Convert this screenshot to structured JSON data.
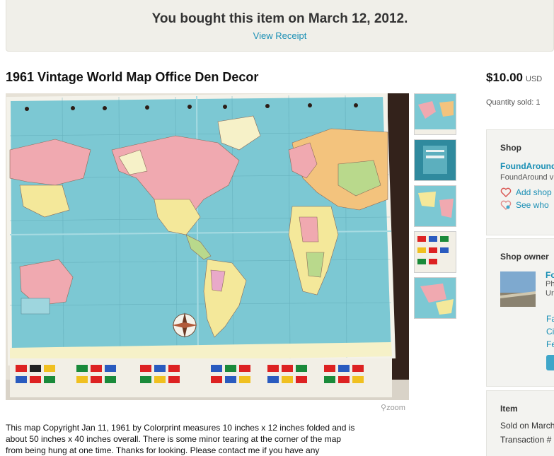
{
  "banner": {
    "title": "You bought this item on March 12, 2012.",
    "link": "View Receipt"
  },
  "listing": {
    "title": "1961 Vintage World Map Office Den Decor",
    "zoom_label": "zoom",
    "description": "This map Copyright Jan 11, 1961 by Colorprint measures 10 inches x 12 inches folded and is about 50 inches x 40 inches overall. There is some minor tearing at the corner of the map from being hung at one time. Thanks for looking. Please contact me if you have any",
    "thumbnails": [
      "thumbnail-1",
      "thumbnail-2",
      "thumbnail-3",
      "thumbnail-4",
      "thumbnail-5"
    ]
  },
  "sidebar": {
    "price": "$10.00",
    "currency": "USD",
    "quantity_sold": "Quantity sold: 1",
    "shop": {
      "heading": "Shop",
      "name": "FoundAround",
      "subtitle": "FoundAround vi",
      "add_label": "Add shop",
      "see_label": "See who"
    },
    "owner": {
      "heading": "Shop owner",
      "name": "Fo",
      "meta_line1": "Ph",
      "meta_line2": "Ur",
      "links": [
        "Fa",
        "Ci",
        "Fe"
      ]
    },
    "item": {
      "heading": "Item",
      "sold_on": "Sold on March",
      "transaction": "Transaction #"
    }
  },
  "colors": {
    "link": "#1a8fb5",
    "banner_bg": "#f0efe9",
    "panel_bg": "#f3f3f0"
  },
  "icons": [
    "heart-icon",
    "heart-share-icon",
    "zoom-icon"
  ]
}
